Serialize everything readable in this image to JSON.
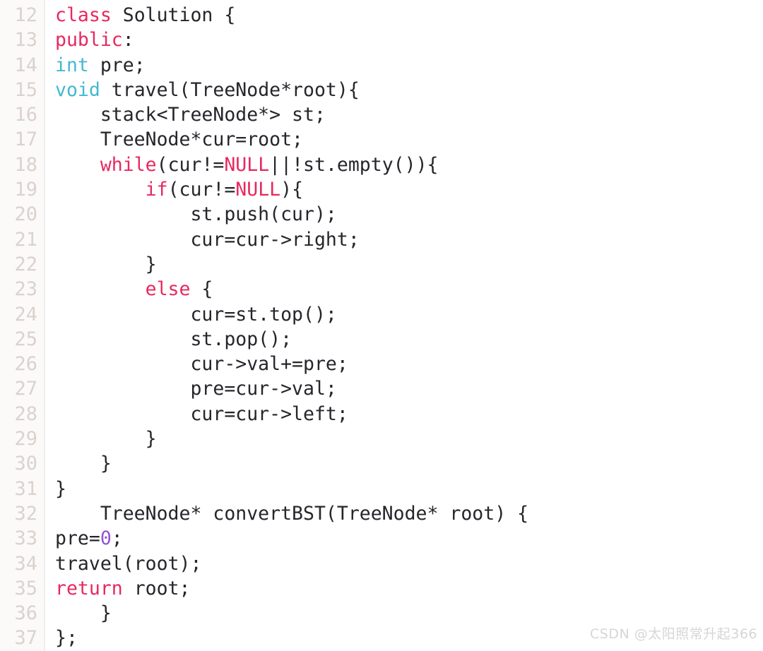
{
  "editor": {
    "language": "cpp",
    "background_color": "#ffffff",
    "gutter_color": "#fbfaf9",
    "text_color": "#25262b",
    "line_number_color": "#dad2ce",
    "first_line_number": 12,
    "last_line_number": 37,
    "colors": {
      "keyword": "#e8285f",
      "type": "#44b8cf",
      "number": "#9353d3",
      "plain": "#25262b"
    },
    "lines": [
      {
        "number": "12",
        "tokens": [
          {
            "text": "class",
            "kind": "keyword"
          },
          {
            "text": " Solution {",
            "kind": "plain"
          }
        ]
      },
      {
        "number": "13",
        "tokens": [
          {
            "text": "public",
            "kind": "keyword"
          },
          {
            "text": ":",
            "kind": "plain"
          }
        ]
      },
      {
        "number": "14",
        "tokens": [
          {
            "text": "int",
            "kind": "type"
          },
          {
            "text": " pre;",
            "kind": "plain"
          }
        ]
      },
      {
        "number": "15",
        "tokens": [
          {
            "text": "void",
            "kind": "type"
          },
          {
            "text": " travel(TreeNode*root){",
            "kind": "plain"
          }
        ]
      },
      {
        "number": "16",
        "tokens": [
          {
            "text": "    stack<TreeNode*> st;",
            "kind": "plain"
          }
        ]
      },
      {
        "number": "17",
        "tokens": [
          {
            "text": "    TreeNode*cur=root;",
            "kind": "plain"
          }
        ]
      },
      {
        "number": "18",
        "tokens": [
          {
            "text": "    ",
            "kind": "plain"
          },
          {
            "text": "while",
            "kind": "keyword"
          },
          {
            "text": "(cur!=",
            "kind": "plain"
          },
          {
            "text": "NULL",
            "kind": "keyword"
          },
          {
            "text": "||!st.empty()){",
            "kind": "plain"
          }
        ]
      },
      {
        "number": "19",
        "tokens": [
          {
            "text": "        ",
            "kind": "plain"
          },
          {
            "text": "if",
            "kind": "keyword"
          },
          {
            "text": "(cur!=",
            "kind": "plain"
          },
          {
            "text": "NULL",
            "kind": "keyword"
          },
          {
            "text": "){",
            "kind": "plain"
          }
        ]
      },
      {
        "number": "20",
        "tokens": [
          {
            "text": "            st.push(cur);",
            "kind": "plain"
          }
        ]
      },
      {
        "number": "21",
        "tokens": [
          {
            "text": "            cur=cur->right;",
            "kind": "plain"
          }
        ]
      },
      {
        "number": "22",
        "tokens": [
          {
            "text": "        }",
            "kind": "plain"
          }
        ]
      },
      {
        "number": "23",
        "tokens": [
          {
            "text": "        ",
            "kind": "plain"
          },
          {
            "text": "else",
            "kind": "keyword"
          },
          {
            "text": " {",
            "kind": "plain"
          }
        ]
      },
      {
        "number": "24",
        "tokens": [
          {
            "text": "            cur=st.top();",
            "kind": "plain"
          }
        ]
      },
      {
        "number": "25",
        "tokens": [
          {
            "text": "            st.pop();",
            "kind": "plain"
          }
        ]
      },
      {
        "number": "26",
        "tokens": [
          {
            "text": "            cur->val+=pre;",
            "kind": "plain"
          }
        ]
      },
      {
        "number": "27",
        "tokens": [
          {
            "text": "            pre=cur->val;",
            "kind": "plain"
          }
        ]
      },
      {
        "number": "28",
        "tokens": [
          {
            "text": "            cur=cur->left;",
            "kind": "plain"
          }
        ]
      },
      {
        "number": "29",
        "tokens": [
          {
            "text": "        }",
            "kind": "plain"
          }
        ]
      },
      {
        "number": "30",
        "tokens": [
          {
            "text": "    }",
            "kind": "plain"
          }
        ]
      },
      {
        "number": "31",
        "tokens": [
          {
            "text": "}",
            "kind": "plain"
          }
        ]
      },
      {
        "number": "32",
        "tokens": [
          {
            "text": "    TreeNode* convertBST(TreeNode* root) {",
            "kind": "plain"
          }
        ]
      },
      {
        "number": "33",
        "tokens": [
          {
            "text": "pre=",
            "kind": "plain"
          },
          {
            "text": "0",
            "kind": "number"
          },
          {
            "text": ";",
            "kind": "plain"
          }
        ]
      },
      {
        "number": "34",
        "tokens": [
          {
            "text": "travel(root);",
            "kind": "plain"
          }
        ]
      },
      {
        "number": "35",
        "tokens": [
          {
            "text": "return",
            "kind": "keyword"
          },
          {
            "text": " root;",
            "kind": "plain"
          }
        ]
      },
      {
        "number": "36",
        "tokens": [
          {
            "text": "    }",
            "kind": "plain"
          }
        ]
      },
      {
        "number": "37",
        "tokens": [
          {
            "text": "};",
            "kind": "plain"
          }
        ]
      }
    ]
  },
  "watermark": {
    "text": "CSDN @太阳照常升起366",
    "color": "#d6d6d6"
  }
}
